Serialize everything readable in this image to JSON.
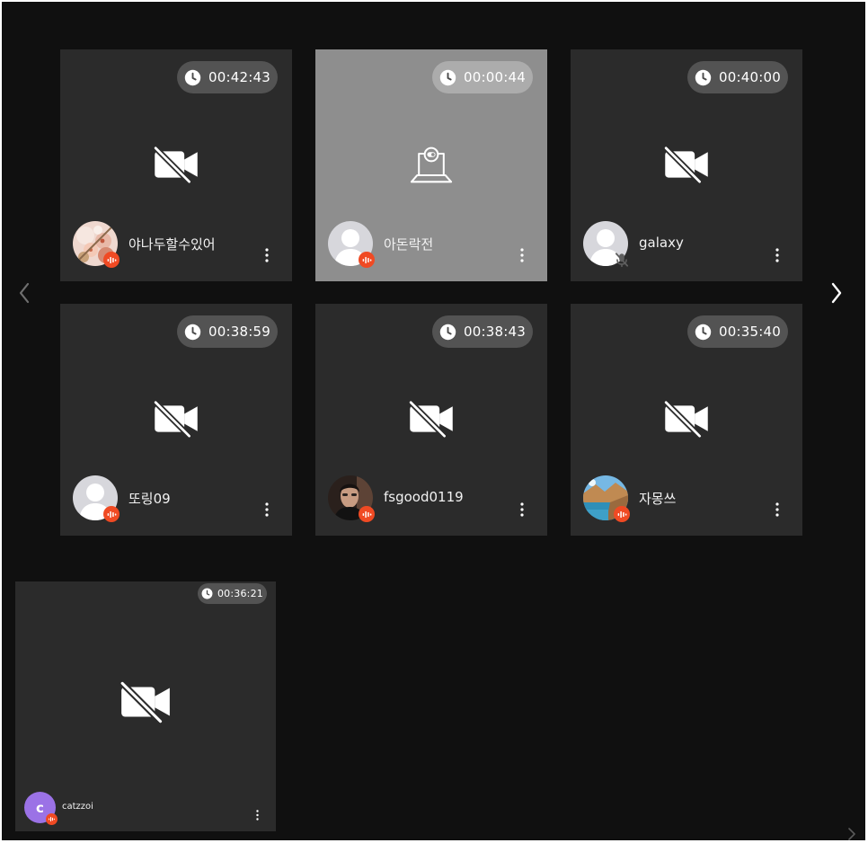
{
  "page": {
    "background": "#101010",
    "tile_color": "#2b2b2b",
    "sharing_tile_color": "#8e8e8e",
    "speaking_badge_color": "#f04a23"
  },
  "navigation": {
    "prev_icon": "chevron-left-icon",
    "next_icon": "chevron-right-icon"
  },
  "participants": [
    {
      "name": "야나두할수있어",
      "duration": "00:42:43",
      "video": "video-off-icon",
      "avatar": "blossom-photo",
      "status": "speaking-icon"
    },
    {
      "name": "아돈락전",
      "duration": "00:00:44",
      "video": "screen-share-icon",
      "avatar": "default-user-avatar",
      "status": "speaking-icon"
    },
    {
      "name": "galaxy",
      "duration": "00:40:00",
      "video": "video-off-icon",
      "avatar": "default-user-avatar",
      "status": "mic-muted-icon"
    },
    {
      "name": "또링09",
      "duration": "00:38:59",
      "video": "video-off-icon",
      "avatar": "default-user-avatar",
      "status": "speaking-icon"
    },
    {
      "name": "fsgood0119",
      "duration": "00:38:43",
      "video": "video-off-icon",
      "avatar": "portrait-photo",
      "status": "speaking-icon"
    },
    {
      "name": "자몽쓰",
      "duration": "00:35:40",
      "video": "video-off-icon",
      "avatar": "landscape-photo",
      "status": "speaking-icon"
    }
  ],
  "self_view": {
    "name": "catzzoi",
    "duration": "00:36:21",
    "video": "video-off-icon",
    "avatar_initial": "c",
    "avatar_color": "#9b72e6",
    "status": "speaking-icon"
  }
}
